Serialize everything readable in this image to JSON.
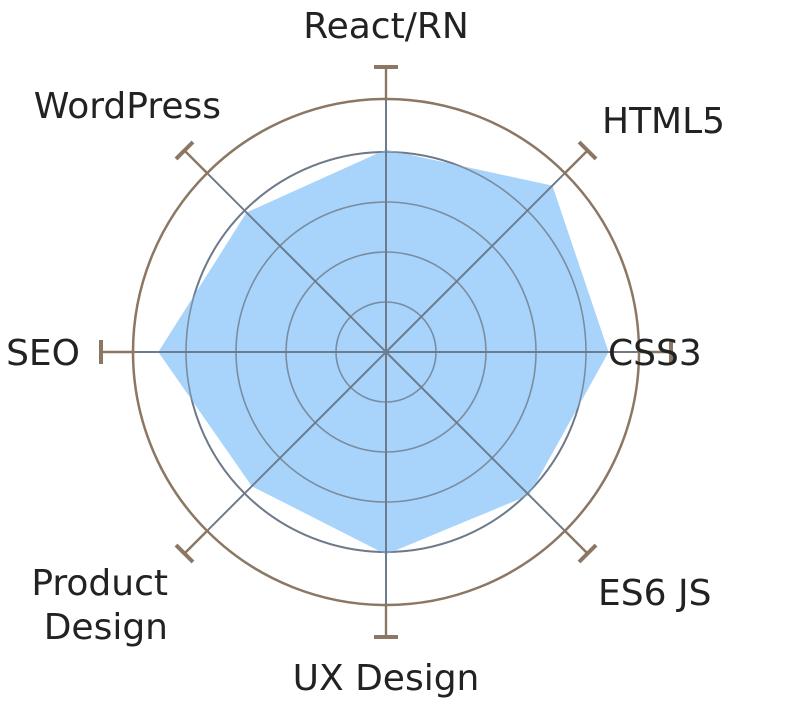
{
  "chart_data": {
    "type": "radar",
    "title": "",
    "axes": [
      "React/RN",
      "HTML5",
      "CSS3",
      "ES6 JS",
      "UX Design",
      "Product Design",
      "SEO",
      "WordPress"
    ],
    "label_lines": [
      [
        "React/RN"
      ],
      [
        "HTML5"
      ],
      [
        "CSS3"
      ],
      [
        "ES6 JS"
      ],
      [
        "UX Design"
      ],
      [
        "Product",
        "Design"
      ],
      [
        "SEO"
      ],
      [
        "WordPress"
      ]
    ],
    "values": [
      0.8,
      0.93,
      0.88,
      0.8,
      0.8,
      0.75,
      0.9,
      0.78
    ],
    "range": [
      0,
      1
    ],
    "rings": 5,
    "grid": true,
    "colors": {
      "fill": "#a8d4fb",
      "grid": "#6e7b8a",
      "ring": "#8b7763",
      "spoke": "#8b7763",
      "label": "#222222"
    }
  }
}
